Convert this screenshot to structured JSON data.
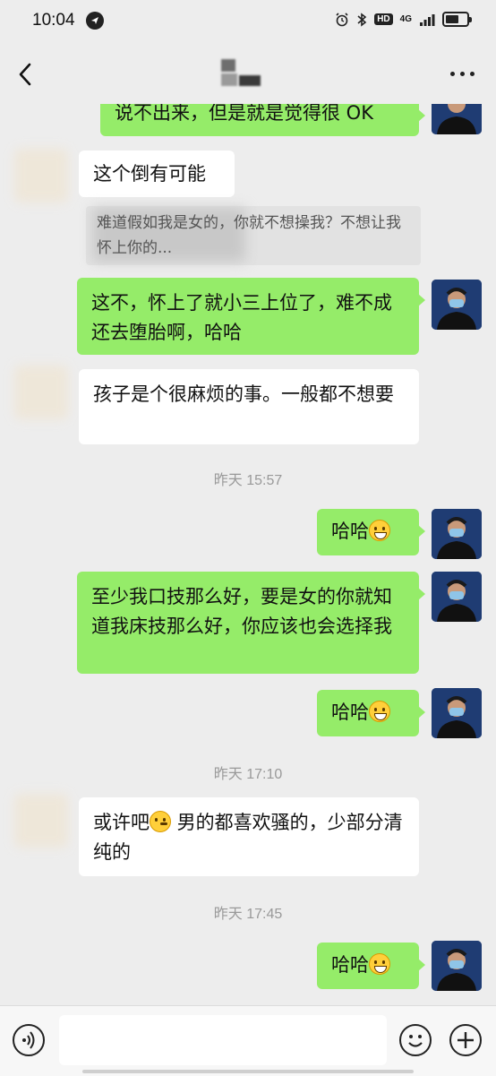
{
  "status_bar": {
    "time": "10:04",
    "hd_label": "HD",
    "network_label": "4G",
    "icons": [
      "navigation-icon",
      "alarm-icon",
      "bluetooth-icon",
      "signal-icon",
      "battery-icon"
    ]
  },
  "header": {
    "back_icon": "chevron-left-icon",
    "title_blurred": true,
    "more_icon": "more-dots-icon"
  },
  "messages": [
    {
      "side": "right",
      "text": "说不出来，但是就是觉得很 OK"
    },
    {
      "side": "left",
      "text": "这个倒有可能"
    },
    {
      "side": "quote",
      "text": "难道假如我是女的，你就不想操我？不想让我怀上你的..."
    },
    {
      "side": "right",
      "text": "这不，怀上了就小三上位了，难不成还去堕胎啊，哈哈"
    },
    {
      "side": "left",
      "text": "孩子是个很麻烦的事。一般都不想要"
    },
    {
      "type": "time",
      "text": "昨天 15:57"
    },
    {
      "side": "right",
      "text": "哈哈",
      "emoji": "grinning-emoji"
    },
    {
      "side": "right",
      "text": "至少我口技那么好，要是女的你就知道我床技那么好，你应该也会选择我"
    },
    {
      "side": "right",
      "text": "哈哈",
      "emoji": "grinning-emoji"
    },
    {
      "type": "time",
      "text": "昨天 17:10"
    },
    {
      "side": "left",
      "text_before": "或许吧",
      "emoji": "thinking-emoji",
      "text_after": " 男的都喜欢骚的，少部分清纯的"
    },
    {
      "type": "time",
      "text": "昨天 17:45"
    },
    {
      "side": "right",
      "text": "哈哈",
      "emoji": "grinning-emoji"
    }
  ],
  "input_bar": {
    "voice_icon": "voice-icon",
    "placeholder": "",
    "emoji_icon": "smiley-icon",
    "plus_icon": "plus-icon"
  },
  "colors": {
    "background": "#ededed",
    "sent_bubble": "#95ec69",
    "received_bubble": "#ffffff",
    "timestamp": "#999999"
  }
}
